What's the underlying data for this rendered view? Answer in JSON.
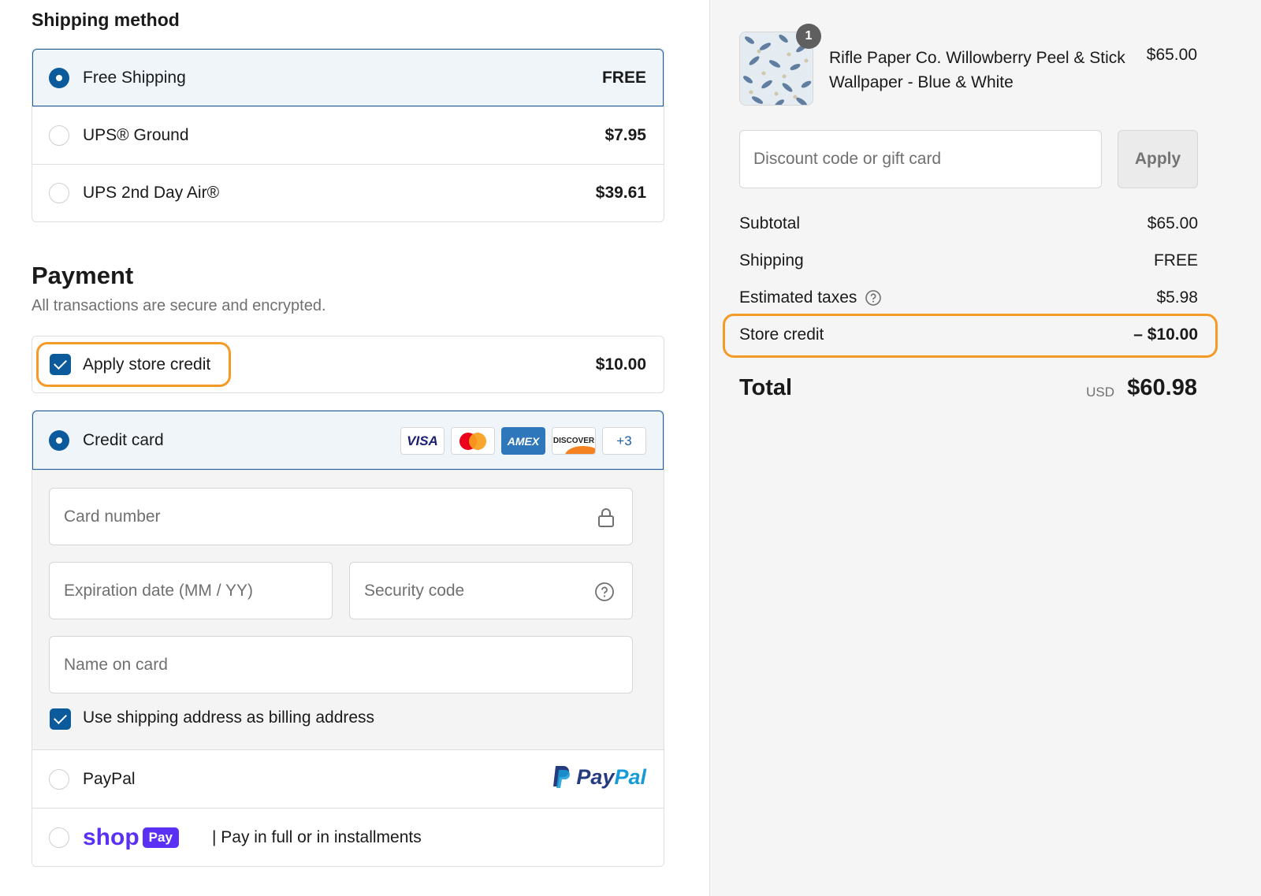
{
  "shipping": {
    "heading": "Shipping method",
    "options": [
      {
        "label": "Free Shipping",
        "price": "FREE",
        "selected": true
      },
      {
        "label": "UPS® Ground",
        "price": "$7.95",
        "selected": false
      },
      {
        "label": "UPS 2nd Day Air®",
        "price": "$39.61",
        "selected": false
      }
    ]
  },
  "payment": {
    "heading": "Payment",
    "subtitle": "All transactions are secure and encrypted.",
    "store_credit": {
      "label": "Apply store credit",
      "amount": "$10.00",
      "checked": true
    },
    "credit_card": {
      "label": "Credit card",
      "brands": [
        "VISA",
        "Mastercard",
        "AMEX",
        "DISCOVER"
      ],
      "more": "+3",
      "card_number_placeholder": "Card number",
      "expiration_placeholder": "Expiration date (MM / YY)",
      "security_placeholder": "Security code",
      "name_placeholder": "Name on card",
      "billing_label": "Use shipping address as billing address"
    },
    "paypal": {
      "label": "PayPal",
      "logo": "PayPal"
    },
    "shoppay": {
      "logo_shop": "shop",
      "logo_pay": "Pay",
      "label": "| Pay in full or in installments"
    }
  },
  "summary": {
    "product": {
      "name": "Rifle Paper Co. Willowberry Peel & Stick Wallpaper - Blue & White",
      "price": "$65.00",
      "quantity": "1"
    },
    "discount_placeholder": "Discount code or gift card",
    "apply_label": "Apply",
    "subtotal_label": "Subtotal",
    "subtotal": "$65.00",
    "shipping_label": "Shipping",
    "shipping": "FREE",
    "taxes_label": "Estimated taxes",
    "taxes": "$5.98",
    "credit_label": "Store credit",
    "credit": "– $10.00",
    "total_label": "Total",
    "currency": "USD",
    "total": "$60.98"
  },
  "colors": {
    "accent": "#0a5a9c",
    "highlight": "#f49a26",
    "shop_purple": "#5a31f4"
  }
}
